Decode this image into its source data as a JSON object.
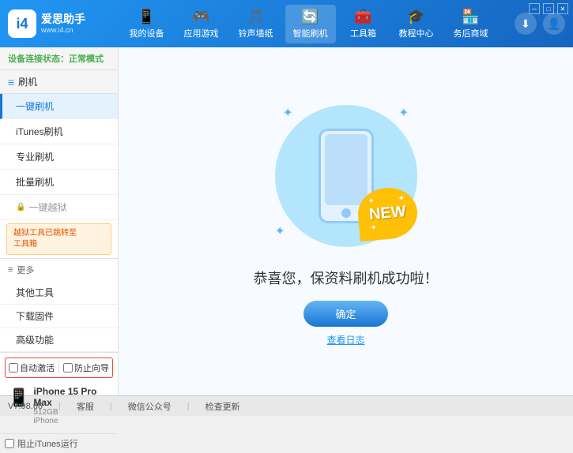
{
  "app": {
    "logo_char": "i4",
    "logo_main": "爱思助手",
    "logo_sub": "www.i4.cn",
    "window_controls": [
      "minimize",
      "maximize",
      "close"
    ]
  },
  "nav": {
    "tabs": [
      {
        "id": "my-device",
        "label": "我的设备",
        "icon": "📱"
      },
      {
        "id": "apps-games",
        "label": "应用游戏",
        "icon": "🎮"
      },
      {
        "id": "ringtones",
        "label": "铃声墙纸",
        "icon": "🎵"
      },
      {
        "id": "smart-flash",
        "label": "智能刷机",
        "icon": "🔄"
      },
      {
        "id": "toolbox",
        "label": "工具箱",
        "icon": "🧰"
      },
      {
        "id": "tutorial",
        "label": "教程中心",
        "icon": "🎓"
      },
      {
        "id": "business",
        "label": "务后商域",
        "icon": "🏪"
      }
    ]
  },
  "sidebar": {
    "status_label": "设备连接状态：",
    "status_value": "正常模式",
    "flash_section": "刷机",
    "items": [
      {
        "id": "one-click-flash",
        "label": "一键刷机",
        "active": true
      },
      {
        "id": "itunes-flash",
        "label": "iTunes刷机",
        "active": false
      },
      {
        "id": "pro-flash",
        "label": "专业刷机",
        "active": false
      },
      {
        "id": "batch-flash",
        "label": "批量刷机",
        "active": false
      }
    ],
    "disabled_item": "一键越狱",
    "warning_text": "越狱工具已跳转至\n工具箱",
    "more_section": "更多",
    "more_items": [
      {
        "id": "other-tools",
        "label": "其他工具"
      },
      {
        "id": "download-firmware",
        "label": "下载固件"
      },
      {
        "id": "advanced",
        "label": "高级功能"
      }
    ],
    "auto_activate_label": "自动激活",
    "guide_label": "防止向导",
    "device_name": "iPhone 15 Pro Max",
    "device_storage": "512GB",
    "device_type": "iPhone",
    "stop_itunes_label": "阻止iTunes运行"
  },
  "content": {
    "success_text": "恭喜您，保资料刷机成功啦！",
    "confirm_btn": "确定",
    "view_log_link": "查看日志",
    "new_badge": "NEW",
    "sparkles": [
      "✦",
      "✦",
      "✦"
    ]
  },
  "footer": {
    "version": "V7.98.66",
    "items": [
      "客服",
      "微信公众号",
      "检查更新"
    ]
  }
}
